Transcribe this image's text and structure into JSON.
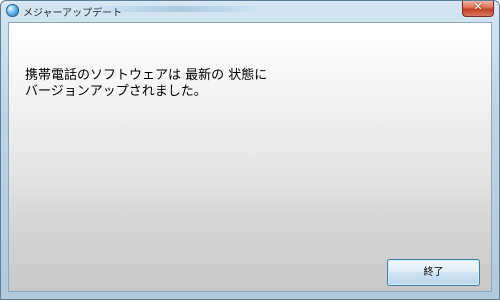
{
  "window": {
    "title": "メジャーアップデート",
    "icon": "globe-app-icon",
    "close_icon": "close-icon",
    "close_label": "✕",
    "accent_color": "#c3402a"
  },
  "content": {
    "message_line1": "携帯電話のソフトウェアは 最新の 状態に",
    "message_line2": "バージョンアップされました。"
  },
  "buttons": {
    "finish_label": "終了"
  }
}
